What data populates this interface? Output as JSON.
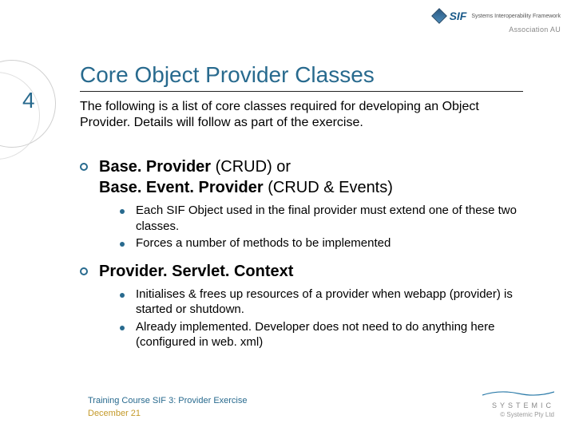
{
  "header": {
    "logo_text": "SIF",
    "logo_sub": "Systems Interoperability Framework",
    "association": "Association AU"
  },
  "slide_number": "4",
  "title": "Core Object Provider Classes",
  "intro": "The following is a list of core classes required for developing an Object Provider. Details will follow as part of the exercise.",
  "items": [
    {
      "main_bold1": "Base. Provider",
      "main_paren1": " (CRUD) ",
      "main_or": "or",
      "main_bold2": "Base. Event. Provider",
      "main_paren2": " (CRUD & Events)",
      "subs": [
        "Each SIF Object used in the final provider must extend one of these two classes.",
        "Forces a number of methods to be implemented"
      ]
    },
    {
      "main_bold1": "Provider. Servlet. Context",
      "subs": [
        "Initialises & frees up resources of a provider when webapp (provider) is started or shutdown.",
        "Already implemented. Developer does not need to do anything here (configured in web. xml)"
      ]
    }
  ],
  "footer": {
    "line1": "Training Course SIF 3: Provider Exercise",
    "line2": "December 21"
  },
  "systemic": {
    "name": "SYSTEMIC",
    "copyright": "© Systemic Pty Ltd"
  }
}
